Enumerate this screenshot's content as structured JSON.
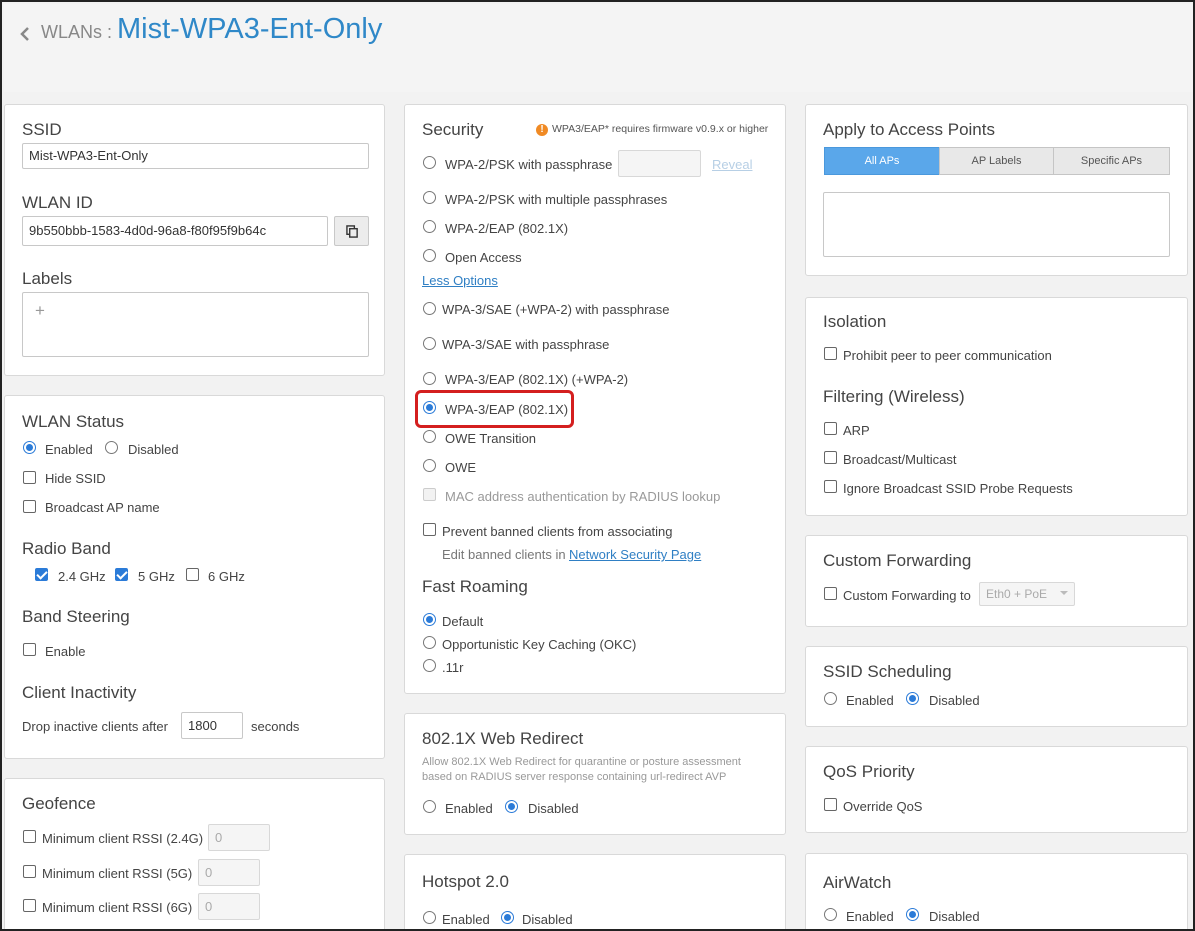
{
  "header": {
    "breadcrumb": "WLANs :",
    "title": "Mist-WPA3-Ent-Only"
  },
  "ssid_card": {
    "ssid_label": "SSID",
    "ssid_value": "Mist-WPA3-Ent-Only",
    "wlan_id_label": "WLAN ID",
    "wlan_id_value": "9b550bbb-1583-4d0d-96a8-f80f95f9b64c",
    "labels_label": "Labels",
    "labels_add": "+"
  },
  "status_card": {
    "wlan_status_title": "WLAN Status",
    "enabled": "Enabled",
    "disabled": "Disabled",
    "hide_ssid": "Hide SSID",
    "broadcast_ap_name": "Broadcast AP name",
    "radio_band_title": "Radio Band",
    "band_24": "2.4 GHz",
    "band_5": "5 GHz",
    "band_6": "6 GHz",
    "band_steering_title": "Band Steering",
    "band_steering_enable": "Enable",
    "client_inactivity_title": "Client Inactivity",
    "drop_prefix": "Drop inactive clients after",
    "drop_value": "1800",
    "drop_suffix": "seconds"
  },
  "geofence_card": {
    "title": "Geofence",
    "rssi_24": "Minimum client RSSI (2.4G)",
    "rssi_5": "Minimum client RSSI (5G)",
    "rssi_6": "Minimum client RSSI (6G)",
    "rssi_value": "0"
  },
  "security_card": {
    "title": "Security",
    "warning": "WPA3/EAP* requires firmware v0.9.x or higher",
    "wpa2_psk": "WPA-2/PSK with passphrase",
    "reveal": "Reveal",
    "wpa2_psk_multi": "WPA-2/PSK with multiple passphrases",
    "wpa2_eap": "WPA-2/EAP (802.1X)",
    "open_access": "Open Access",
    "less_options": "Less Options",
    "wpa3_sae_wpa2": "WPA-3/SAE (+WPA-2) with passphrase",
    "wpa3_sae": "WPA-3/SAE with passphrase",
    "wpa3_eap_wpa2": "WPA-3/EAP (802.1X) (+WPA-2)",
    "wpa3_eap": "WPA-3/EAP (802.1X)",
    "owe_transition": "OWE Transition",
    "owe": "OWE",
    "mac_auth": "MAC address authentication by RADIUS lookup",
    "prevent_banned": "Prevent banned clients from associating",
    "edit_banned_prefix": "Edit banned clients in",
    "network_security_page": "Network Security Page",
    "fast_roaming_title": "Fast Roaming",
    "roam_default": "Default",
    "roam_okc": "Opportunistic Key Caching (OKC)",
    "roam_11r": ".11r"
  },
  "web_redirect_card": {
    "title": "802.1X Web Redirect",
    "desc_line1": "Allow 802.1X Web Redirect for quarantine or posture assessment",
    "desc_line2": "based on RADIUS server response containing url-redirect AVP",
    "enabled": "Enabled",
    "disabled": "Disabled"
  },
  "hotspot_card": {
    "title": "Hotspot 2.0",
    "enabled": "Enabled",
    "disabled": "Disabled"
  },
  "apply_card": {
    "title": "Apply to Access Points",
    "all_aps": "All APs",
    "ap_labels": "AP Labels",
    "specific_aps": "Specific APs"
  },
  "isolation_card": {
    "title": "Isolation",
    "prohibit_p2p": "Prohibit peer to peer communication",
    "filtering_title": "Filtering (Wireless)",
    "arp": "ARP",
    "broadcast_multicast": "Broadcast/Multicast",
    "ignore_probe": "Ignore Broadcast SSID Probe Requests"
  },
  "forwarding_card": {
    "title": "Custom Forwarding",
    "custom_forwarding_to": "Custom Forwarding to",
    "select_value": "Eth0 + PoE"
  },
  "scheduling_card": {
    "title": "SSID Scheduling",
    "enabled": "Enabled",
    "disabled": "Disabled"
  },
  "qos_card": {
    "title": "QoS Priority",
    "override_qos": "Override QoS"
  },
  "airwatch_card": {
    "title": "AirWatch",
    "enabled": "Enabled",
    "disabled": "Disabled"
  },
  "colors": {
    "accent": "#2f88c8",
    "selected_blue": "#2b7bd8",
    "highlight_red": "#d41f1f",
    "warning_orange": "#f08a24"
  }
}
